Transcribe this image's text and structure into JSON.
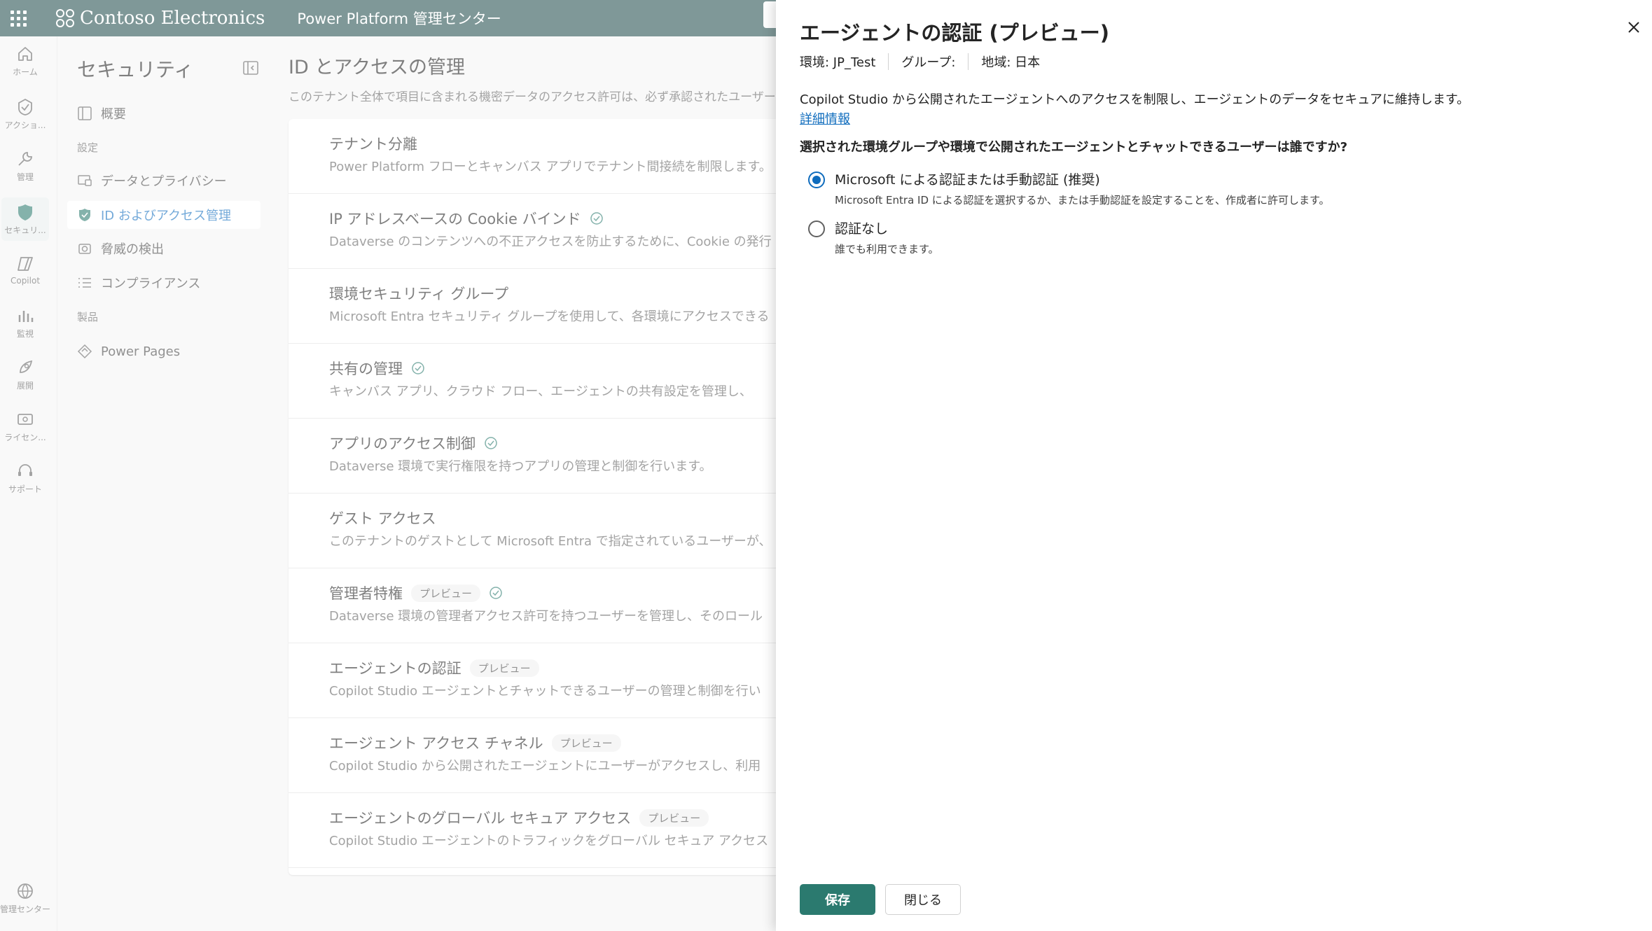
{
  "topbar": {
    "brand": "Contoso Electronics",
    "product": "Power Platform 管理センター"
  },
  "rail": {
    "items": [
      {
        "icon": "home-icon",
        "label": "ホーム"
      },
      {
        "icon": "actions-icon",
        "label": "アクショ..."
      },
      {
        "icon": "manage-icon",
        "label": "管理"
      },
      {
        "icon": "shield-icon",
        "label": "セキュリ...",
        "active": true
      },
      {
        "icon": "copilot-icon",
        "label": "Copilot"
      },
      {
        "icon": "monitor-icon",
        "label": "監視"
      },
      {
        "icon": "deploy-icon",
        "label": "展開"
      },
      {
        "icon": "license-icon",
        "label": "ライセン..."
      },
      {
        "icon": "support-icon",
        "label": "サポート"
      }
    ],
    "bottom": {
      "icon": "globe-icon",
      "label": "管理センター"
    }
  },
  "secnav": {
    "title": "セキュリティ",
    "overview": "概要",
    "section_settings": "設定",
    "data_privacy": "データとプライバシー",
    "identity_access": "ID およびアクセス管理",
    "threat_detection": "脅威の検出",
    "compliance": "コンプライアンス",
    "section_products": "製品",
    "power_pages": "Power Pages"
  },
  "main": {
    "title": "ID とアクセスの管理",
    "description": "このテナント全体で項目に含まれる機密データのアクセス許可は、必ず承認されたユーザーのみに",
    "rows": [
      {
        "title": "テナント分離",
        "desc": "Power Platform フローとキャンバス アプリでテナント間接続を制限します。",
        "badge": "",
        "check": false
      },
      {
        "title": "IP アドレスベースの Cookie バインド",
        "desc": "Dataverse のコンテンツへの不正アクセスを防止するために、Cookie の発行",
        "badge": "",
        "check": true
      },
      {
        "title": "環境セキュリティ グループ",
        "desc": "Microsoft Entra セキュリティ グループを使用して、各環境にアクセスできる",
        "badge": "",
        "check": false
      },
      {
        "title": "共有の管理",
        "desc": "キャンバス アプリ、クラウド フロー、エージェントの共有設定を管理し、",
        "badge": "",
        "check": true
      },
      {
        "title": "アプリのアクセス制御",
        "desc": "Dataverse 環境で実行権限を持つアプリの管理と制御を行います。",
        "badge": "",
        "check": true
      },
      {
        "title": "ゲスト アクセス",
        "desc": "このテナントのゲストとして Microsoft Entra で指定されているユーザーが、",
        "badge": "",
        "check": false
      },
      {
        "title": "管理者特権",
        "desc": "Dataverse 環境の管理者アクセス許可を持つユーザーを管理し、そのロール",
        "badge": "プレビュー",
        "check": true
      },
      {
        "title": "エージェントの認証",
        "desc": "Copilot Studio エージェントとチャットできるユーザーの管理と制御を行い",
        "badge": "プレビュー",
        "check": false
      },
      {
        "title": "エージェント アクセス チャネル",
        "desc": "Copilot Studio から公開されたエージェントにユーザーがアクセスし、利用",
        "badge": "プレビュー",
        "check": false
      },
      {
        "title": "エージェントのグローバル セキュア アクセス",
        "desc": "Copilot Studio エージェントのトラフィックをグローバル セキュア アクセス",
        "badge": "プレビュー",
        "check": false
      }
    ]
  },
  "panel": {
    "title": "エージェントの認証 (プレビュー)",
    "env": "環境: JP_Test",
    "group": "グループ:",
    "region": "地域: 日本",
    "description": "Copilot Studio から公開されたエージェントへのアクセスを制限し、エージェントのデータをセキュアに維持します。",
    "learn_more": "詳細情報",
    "question": "選択された環境グループや環境で公開されたエージェントとチャットできるユーザーは誰ですか?",
    "options": [
      {
        "label": "Microsoft による認証または手動認証 (推奨)",
        "help": "Microsoft Entra ID による認証を選択するか、または手動認証を設定することを、作成者に許可します。",
        "checked": true
      },
      {
        "label": "認証なし",
        "help": "誰でも利用できます。",
        "checked": false
      }
    ],
    "save": "保存",
    "close": "閉じる"
  },
  "colors": {
    "topbar": "#244f4f",
    "accent": "#0f6cbd",
    "primary_button": "#2b7a6f"
  }
}
